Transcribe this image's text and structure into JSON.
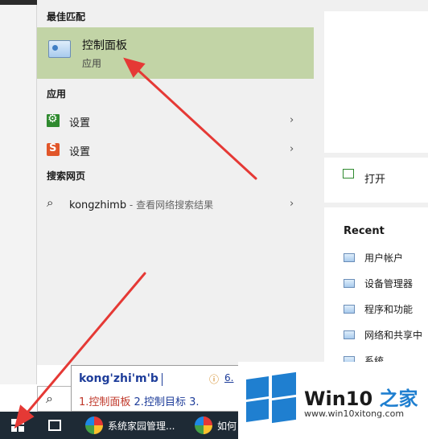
{
  "start_menu": {
    "best_match_header": "最佳匹配",
    "best_match": {
      "title": "控制面板",
      "subtitle": "应用",
      "icon": "control-panel-icon"
    },
    "apps_header": "应用",
    "apps": [
      {
        "label": "设置",
        "icon": "gear-icon"
      },
      {
        "label": "设置",
        "icon": "s-icon"
      }
    ],
    "web_header": "搜索网页",
    "web": {
      "query": "kongzhimb",
      "suffix": " - 查看网络搜索结果"
    },
    "chevron": "›"
  },
  "preview": {
    "open_label": "打开",
    "recent_header": "Recent",
    "recent_items": [
      "用户帐户",
      "设备管理器",
      "程序和功能",
      "网络和共享中",
      "系统"
    ]
  },
  "search": {
    "ime_typed": "kong'zhi'm'b",
    "ime_info": "ⓘ",
    "ime_info_num": "6.",
    "candidate_1": "1.控制面板",
    "candidate_2": " 2.控制目标",
    "candidate_3": " 3.",
    "search_glyph": "⌕"
  },
  "taskbar": {
    "app1": "系统家园管理...",
    "app2": "如何"
  },
  "watermark": {
    "brand": "Win10",
    "brand_zh": " 之家",
    "url": "www.win10xitong.com"
  },
  "colors": {
    "best_match_bg": "#c2d4a6",
    "arrow": "#e53935",
    "taskbar": "#1e2a35"
  }
}
